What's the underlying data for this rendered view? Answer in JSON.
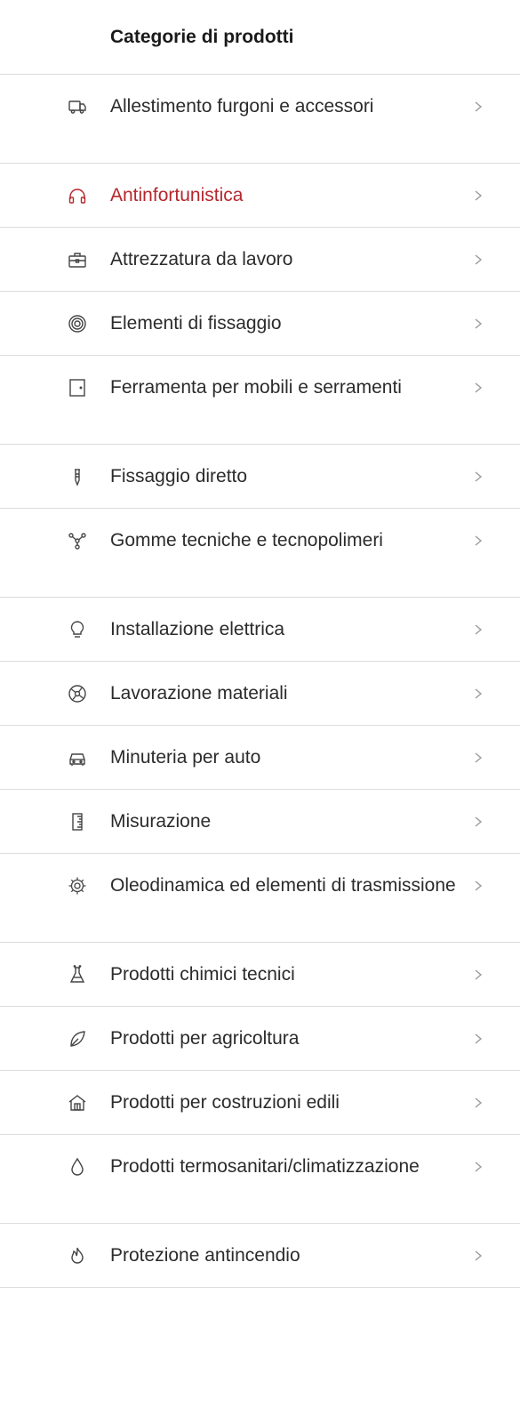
{
  "menu": {
    "title": "Categorie di prodotti",
    "active_color": "#b5272c",
    "items": [
      {
        "label": "Allestimento furgoni e accessori",
        "icon": "van-icon",
        "lines": 2
      },
      {
        "label": "Antinfortunistica",
        "icon": "headphones-icon",
        "lines": 1,
        "active": true
      },
      {
        "label": "Attrezzatura da lavoro",
        "icon": "toolbox-icon",
        "lines": 1
      },
      {
        "label": "Elementi di fissaggio",
        "icon": "nut-icon",
        "lines": 1
      },
      {
        "label": "Ferramenta per mobili e serramenti",
        "icon": "door-icon",
        "lines": 2
      },
      {
        "label": "Fissaggio diretto",
        "icon": "nail-icon",
        "lines": 1
      },
      {
        "label": "Gomme tecniche e tecnopolimeri",
        "icon": "molecule-icon",
        "lines": 2
      },
      {
        "label": "Installazione elettrica",
        "icon": "lightbulb-icon",
        "lines": 1
      },
      {
        "label": "Lavorazione materiali",
        "icon": "cutting-disc-icon",
        "lines": 1
      },
      {
        "label": "Minuteria per auto",
        "icon": "car-icon",
        "lines": 1
      },
      {
        "label": "Misurazione",
        "icon": "ruler-icon",
        "lines": 1
      },
      {
        "label": "Oleodinamica ed elementi di trasmissione",
        "icon": "gear-icon",
        "lines": 2
      },
      {
        "label": "Prodotti chimici tecnici",
        "icon": "flask-icon",
        "lines": 1
      },
      {
        "label": "Prodotti per agricoltura",
        "icon": "leaf-icon",
        "lines": 1
      },
      {
        "label": "Prodotti per costruzioni edili",
        "icon": "house-icon",
        "lines": 1
      },
      {
        "label": "Prodotti termosanitari/climatizzazione",
        "icon": "drop-icon",
        "lines": 2
      },
      {
        "label": "Protezione antincendio",
        "icon": "flame-icon",
        "lines": 1
      }
    ]
  }
}
